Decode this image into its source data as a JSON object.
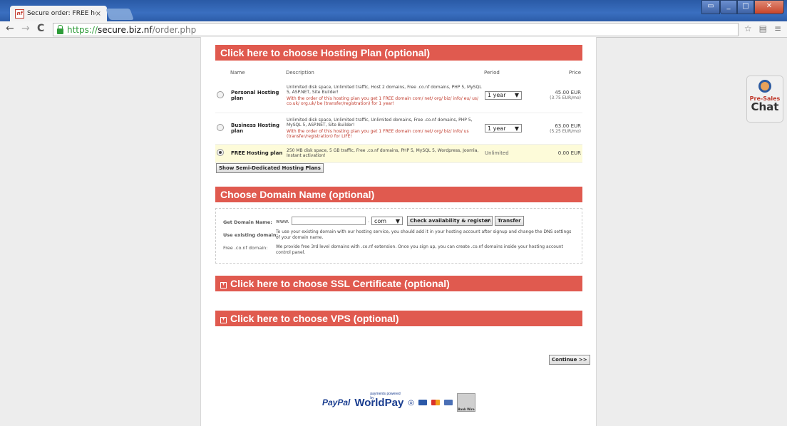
{
  "browser": {
    "tab_title": "Secure order: FREE hostin",
    "tab_favicon": "nf",
    "close_tab": "×",
    "url_scheme": "https://",
    "url_host": "secure.biz.nf",
    "url_path": "/order.php",
    "nav": {
      "back": "←",
      "forward": "→",
      "reload": "C"
    },
    "right_icons": {
      "star": "☆",
      "page": "▤",
      "menu": "≡"
    }
  },
  "hosting": {
    "heading": "Click here to choose Hosting Plan (optional)",
    "columns": {
      "name": "Name",
      "description": "Description",
      "period": "Period",
      "price": "Price"
    },
    "plans": [
      {
        "name": "Personal Hosting plan",
        "description": "Unlimited disk space, Unlimited traffic, Host 2 domains, Free .co.nf domains, PHP 5, MySQL 5, ASP.NET, Site Builder!",
        "promo": "With the order of this hosting plan you get 1 FREE domain com/ net/ org/ biz/ info/ eu/ us/ co.uk/ org.uk/ be (transfer/registration) for 1 year!",
        "period": "1 year",
        "price": "45.00 EUR",
        "price_mo": "(3.75 EUR/mo)",
        "selected": false
      },
      {
        "name": "Business Hosting plan",
        "description": "Unlimited disk space, Unlimited traffic, Unlimited domains, Free .co.nf domains, PHP 5, MySQL 5, ASP.NET, Site Builder!",
        "promo": "With the order of this hosting plan you get 1 FREE domain com/ net/ org/ biz/ info/ us (transfer/registration) for LIFE!",
        "period": "1 year",
        "price": "63.00 EUR",
        "price_mo": "(5.25 EUR/mo)",
        "selected": false
      },
      {
        "name": "FREE Hosting plan",
        "description": "250 MB disk space, 5 GB traffic, Free .co.nf domains, PHP 5, MySQL 5, Wordpress, Joomla, Instant activation!",
        "period": "Unlimited",
        "price": "0.00 EUR",
        "selected": true
      }
    ],
    "semi_dedicated_button": "Show Semi-Dedicated Hosting Plans"
  },
  "domain": {
    "heading": "Choose Domain Name (optional)",
    "get_label": "Get Domain Name:",
    "www_prefix": "www.",
    "input_value": "",
    "dot": ".",
    "tld": "com",
    "check_button": "Check availability & register",
    "or_text": "OR",
    "transfer_button": "Transfer",
    "existing_label": "Use existing domain:",
    "existing_text": "To use your existing domain with our hosting service, you should add it in your hosting account after signup and change the DNS settings of your domain name.",
    "free_label": "Free .co.nf domain:",
    "free_text": "We provide free 3rd level domains with .co.nf extension. Once you sign up, you can create .co.nf domains inside your hosting account control panel."
  },
  "ssl": {
    "heading": "Click here to choose SSL Certificate (optional)"
  },
  "vps": {
    "heading": "Click here to choose VPS (optional)"
  },
  "continue_button": "Continue >>",
  "payment": {
    "paypal": "PayPal",
    "worldpay": "WorldPay",
    "worldpay_caption": "payments powered by",
    "bank_wire": "Bank Wire"
  },
  "chat": {
    "line1": "Pre-Sales",
    "line2": "Chat"
  },
  "colors": {
    "section_red": "#e05a4f",
    "free_row": "#fdfbd9",
    "secure_green": "#2e9c39"
  }
}
